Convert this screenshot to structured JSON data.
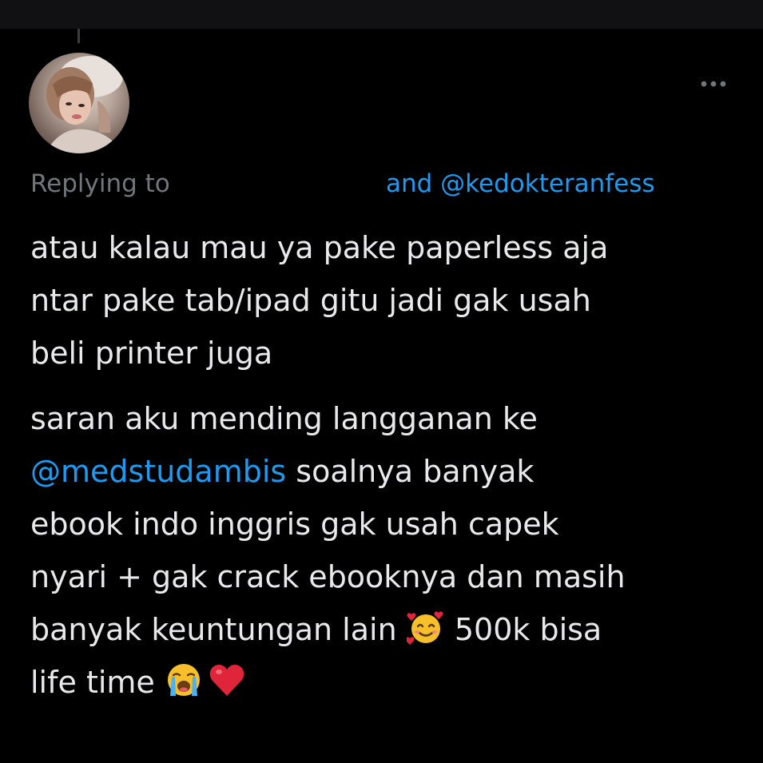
{
  "tweet": {
    "reply_label": "Replying to",
    "reply_handles": "and @kedokteranfess",
    "more_icon": "more-horizontal-icon",
    "paragraph1": {
      "line1": "atau kalau mau ya pake paperless aja",
      "line2": "ntar pake tab/ipad gitu jadi gak usah",
      "line3": "beli printer juga"
    },
    "paragraph2": {
      "line1": "saran aku mending langganan ke",
      "mention": "@medstudambis",
      "line2_rest": " soalnya banyak",
      "line3": "ebook indo inggris gak usah capek",
      "line4": "nyari + gak crack ebooknya dan masih",
      "line5_start": "banyak keuntungan lain ",
      "line5_end": " 500k bisa",
      "line6_start": "life time "
    },
    "emoji": {
      "smiling_hearts": "smiling-face-with-hearts-icon",
      "crying": "loudly-crying-face-icon",
      "heart": "red-heart-icon"
    },
    "colors": {
      "background": "#000000",
      "text": "#e7e9ea",
      "muted": "#71767b",
      "link": "#1d9bf0"
    }
  }
}
